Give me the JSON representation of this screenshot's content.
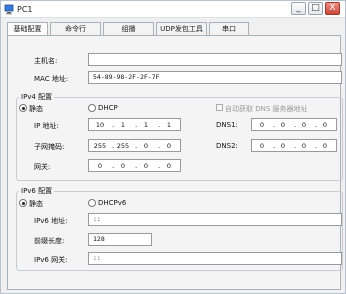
{
  "window": {
    "title": "PC1",
    "minimize": "_",
    "maximize": "□",
    "close": "X"
  },
  "tabs": [
    "基础配置",
    "命令行",
    "组播",
    "UDP发包工具",
    "串口"
  ],
  "basic": {
    "hostname_label": "主机名:",
    "hostname_value": "",
    "mac_label": "MAC 地址:",
    "mac_value": "54-89-98-2F-2F-7F"
  },
  "ipv4": {
    "group_title": "IPv4 配置",
    "static_label": "静态",
    "dhcp_label": "DHCP",
    "auto_dns_label": "自动获取 DNS 服务器地址",
    "ip_label": "IP 地址:",
    "ip": [
      "10",
      "1",
      "1",
      "1"
    ],
    "mask_label": "子网掩码:",
    "mask": [
      "255",
      "255",
      "0",
      "0"
    ],
    "gateway_label": "网关:",
    "gateway": [
      "0",
      "0",
      "0",
      "0"
    ],
    "dns1_label": "DNS1:",
    "dns1": [
      "0",
      "0",
      "0",
      "0"
    ],
    "dns2_label": "DNS2:",
    "dns2": [
      "0",
      "0",
      "0",
      "0"
    ]
  },
  "ipv6": {
    "group_title": "IPv6 配置",
    "static_label": "静态",
    "dhcp_label": "DHCPv6",
    "addr_label": "IPv6 地址:",
    "addr_value": "::",
    "prefix_label": "前缀长度:",
    "prefix_value": "128",
    "gateway_label": "IPv6 网关:",
    "gateway_value": "::"
  }
}
